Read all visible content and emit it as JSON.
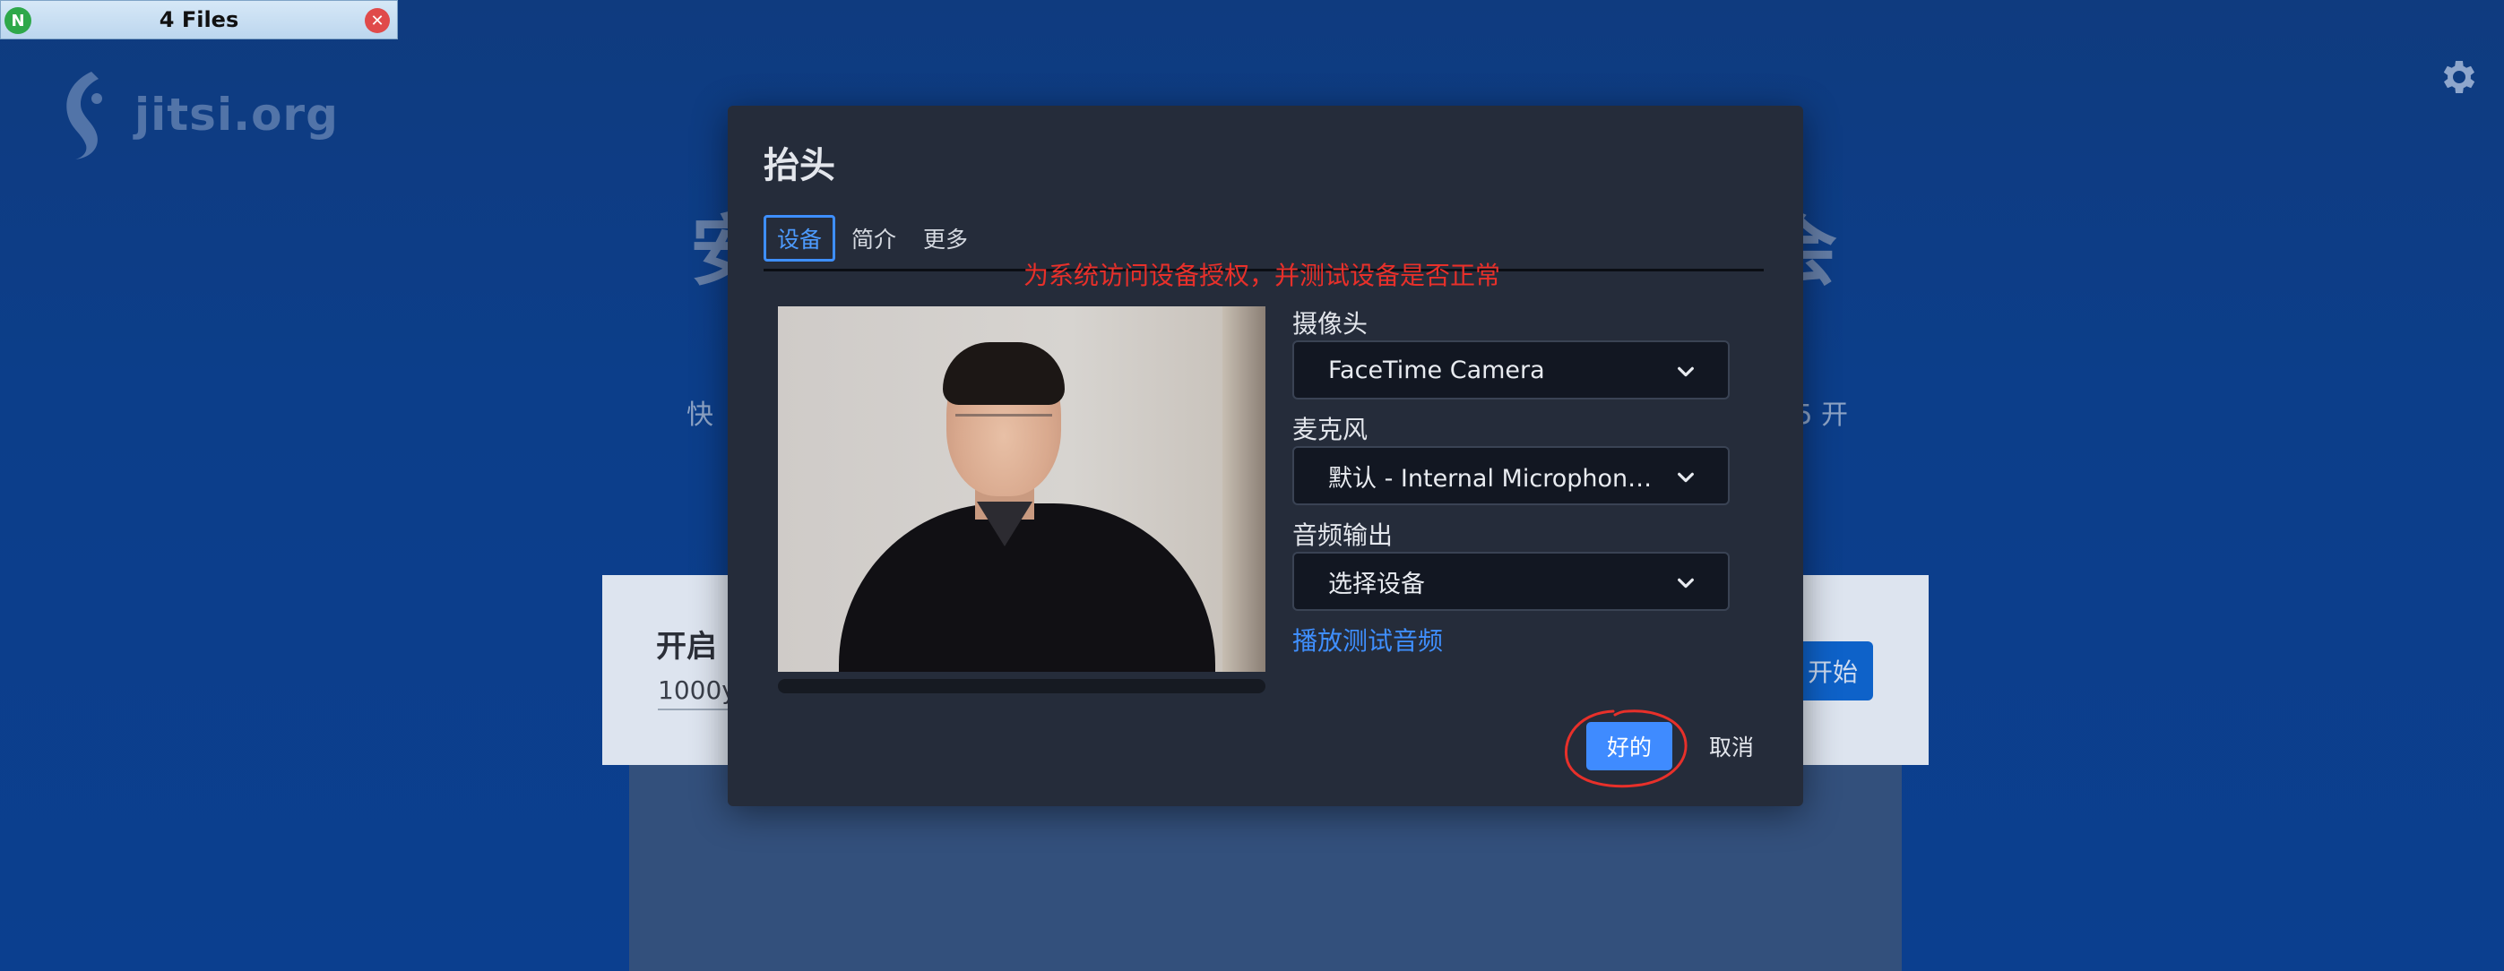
{
  "window": {
    "title": "4 Files"
  },
  "background": {
    "logo_text": "jitsi.org",
    "heading_left": "安",
    "heading_right": "会",
    "subtitle_left": "快",
    "subtitle_right": "5 开",
    "card_title": "开启",
    "card_input_value": "1000y",
    "start_button": "开始"
  },
  "dialog": {
    "title": "抬头",
    "tabs": [
      {
        "label": "设备",
        "active": true
      },
      {
        "label": "简介",
        "active": false
      },
      {
        "label": "更多",
        "active": false
      }
    ],
    "annotation": "为系统访问设备授权，并测试设备是否正常",
    "camera": {
      "label": "摄像头",
      "value": "FaceTime Camera"
    },
    "microphone": {
      "label": "麦克风",
      "value": "默认 - Internal Microphone (Built-in)"
    },
    "audio_output": {
      "label": "音频输出",
      "value": "选择设备"
    },
    "play_test_sound": "播放测试音频",
    "ok_button": "好的",
    "cancel_button": "取消"
  },
  "colors": {
    "accent": "#3f8bff",
    "annotation": "#e8302a",
    "dialog_bg": "#252c3a"
  }
}
